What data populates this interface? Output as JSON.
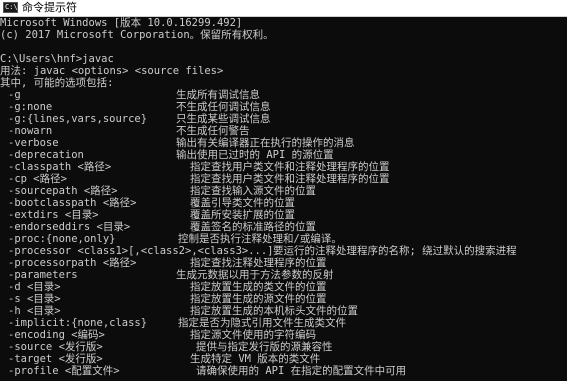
{
  "window": {
    "title": "命令提示符",
    "icon": "cmd-icon",
    "icon_text": "C:\\"
  },
  "header_lines": [
    "Microsoft Windows [版本 10.0.16299.492]",
    "(c) 2017 Microsoft Corporation。保留所有权利。",
    "",
    "C:\\Users\\hnf>javac",
    "用法: javac <options> <source files>",
    "其中, 可能的选项包括:"
  ],
  "options": [
    {
      "opt": "-g",
      "desc": "生成所有调试信息"
    },
    {
      "opt": "-g:none",
      "desc": "不生成任何调试信息"
    },
    {
      "opt": "-g:{lines,vars,source}",
      "desc": "只生成某些调试信息"
    },
    {
      "opt": "-nowarn",
      "desc": "不生成任何警告"
    },
    {
      "opt": "-verbose",
      "desc": "输出有关编译器正在执行的操作的消息"
    },
    {
      "opt": "-deprecation",
      "desc": "输出使用已过时的 API 的源位置"
    },
    {
      "opt": "-classpath <路径>",
      "desc": "指定查找用户类文件和注释处理程序的位置"
    },
    {
      "opt": "-cp <路径>",
      "desc": "指定查找用户类文件和注释处理程序的位置"
    },
    {
      "opt": "-sourcepath <路径>",
      "desc": "指定查找输入源文件的位置"
    },
    {
      "opt": "-bootclasspath <路径>",
      "desc": "覆盖引导类文件的位置"
    },
    {
      "opt": "-extdirs <目录>",
      "desc": "覆盖所安装扩展的位置"
    },
    {
      "opt": "-endorseddirs <目录>",
      "desc": "覆盖签名的标准路径的位置"
    },
    {
      "opt": "-proc:{none,only}",
      "desc": "控制是否执行注释处理和/或编译。"
    },
    {
      "opt": "-processor <class1>[,<class2>,<class3>...]",
      "desc": "要运行的注释处理程序的名称; 绕过默认的搜索进程"
    },
    {
      "opt": "-processorpath <路径>",
      "desc": "指定查找注释处理程序的位置"
    },
    {
      "opt": "-parameters",
      "desc": "生成元数据以用于方法参数的反射"
    },
    {
      "opt": "-d <目录>",
      "desc": "指定放置生成的类文件的位置"
    },
    {
      "opt": "-s <目录>",
      "desc": "指定放置生成的源文件的位置"
    },
    {
      "opt": "-h <目录>",
      "desc": "指定放置生成的本机标头文件的位置"
    },
    {
      "opt": "-implicit:{none,class}",
      "desc": "指定是否为隐式引用文件生成类文件"
    },
    {
      "opt": "-encoding <编码>",
      "desc": "指定源文件使用的字符编码"
    },
    {
      "opt": "-source <发行版>",
      "desc": "提供与指定发行版的源兼容性"
    },
    {
      "opt": "-target <发行版>",
      "desc": "生成特定 VM 版本的类文件"
    },
    {
      "opt": "-profile <配置文件>",
      "desc": "请确保使用的 API 在指定的配置文件中可用"
    }
  ],
  "colors": {
    "console_bg": "#0c0c0c",
    "console_fg": "#cccccc",
    "titlebar_bg": "#ffffff"
  }
}
